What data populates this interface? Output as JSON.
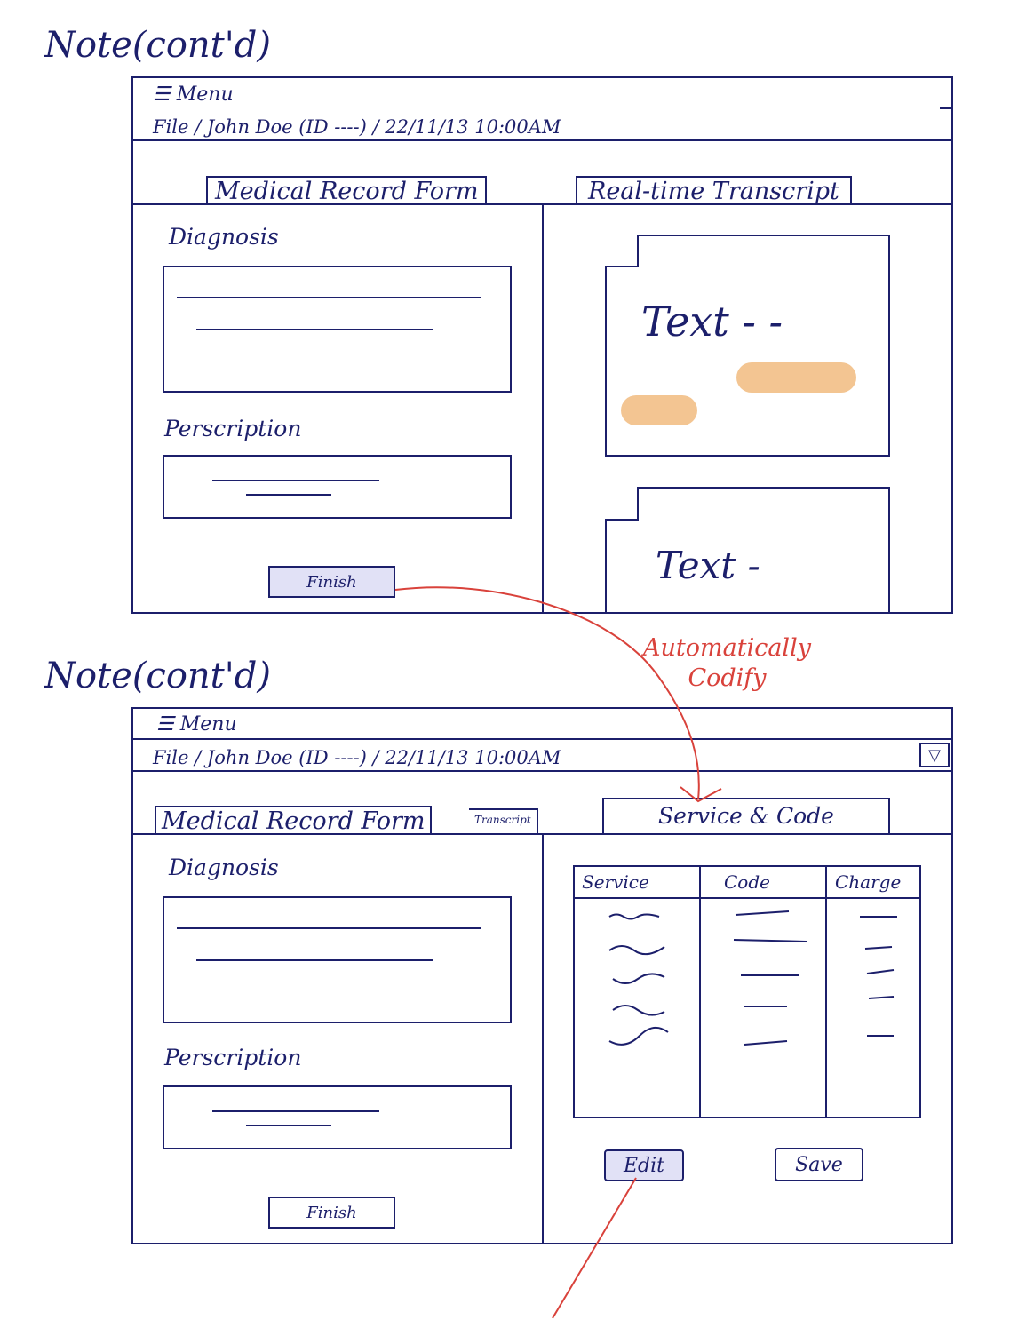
{
  "panel1": {
    "note_title": "Note(cont'd)",
    "menu_label": "Menu",
    "file_breadcrumb": "File / John Doe (ID ----) / 22/11/13 10:00AM",
    "tab_form": "Medical Record Form",
    "tab_transcript": "Real-time Transcript",
    "diagnosis_label": "Diagnosis",
    "prescription_label": "Perscription",
    "finish_label": "Finish",
    "transcript_text_1": "Text - -",
    "transcript_text_2": "Text -"
  },
  "annotation": {
    "text": "Automatically Codify"
  },
  "panel2": {
    "note_title": "Note(cont'd)",
    "menu_label": "Menu",
    "file_breadcrumb": "File / John Doe (ID ----) / 22/11/13 10:00AM",
    "tab_form": "Medical Record Form",
    "tab_transcript_small": "Transcript",
    "tab_service_code": "Service & Code",
    "diagnosis_label": "Diagnosis",
    "prescription_label": "Perscription",
    "finish_label": "Finish",
    "table_headers": [
      "Service",
      "Code",
      "Charge"
    ],
    "edit_label": "Edit",
    "save_label": "Save"
  },
  "colors": {
    "ink": "#1c1f6b",
    "highlight": "#f3c592",
    "button_highlight": "#e1e1f6",
    "annotation_red": "#d9423b"
  },
  "icons": [
    "menu-icon",
    "dropdown-chevron-icon"
  ]
}
